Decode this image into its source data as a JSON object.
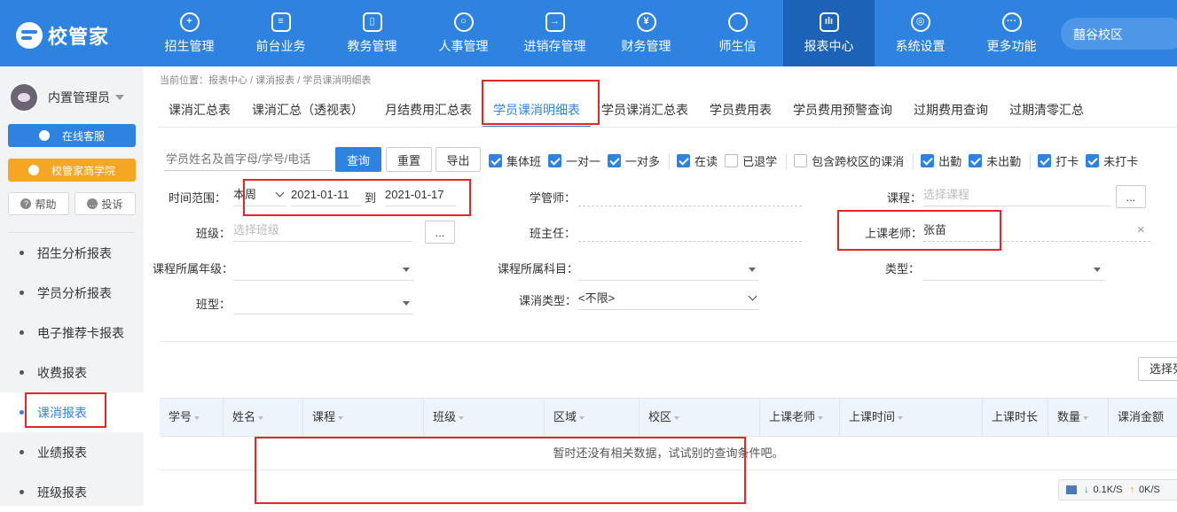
{
  "brand": {
    "name": "校管家"
  },
  "nav": [
    {
      "label": "招生管理",
      "icon": "user-plus-icon",
      "glyph": "+"
    },
    {
      "label": "前台业务",
      "icon": "front-desk-icon",
      "glyph": "≡"
    },
    {
      "label": "教务管理",
      "icon": "book-icon",
      "glyph": "▯"
    },
    {
      "label": "人事管理",
      "icon": "person-icon",
      "glyph": "○"
    },
    {
      "label": "进销存管理",
      "icon": "inventory-icon",
      "glyph": "→"
    },
    {
      "label": "财务管理",
      "icon": "yuan-icon",
      "glyph": "¥"
    },
    {
      "label": "师生信",
      "icon": "chat-icon",
      "glyph": ""
    },
    {
      "label": "报表中心",
      "icon": "chart-icon",
      "glyph": "ılı"
    },
    {
      "label": "系统设置",
      "icon": "gear-icon",
      "glyph": "◎"
    },
    {
      "label": "更多功能",
      "icon": "more-icon",
      "glyph": "···"
    }
  ],
  "campus": "囍谷校区",
  "user": {
    "name": "内置管理员"
  },
  "sidebar": {
    "online_service": "在线客服",
    "academy": "校管家商学院",
    "help": "帮助",
    "complaint": "投诉",
    "menu": [
      "招生分析报表",
      "学员分析报表",
      "电子推荐卡报表",
      "收费报表",
      "课消报表",
      "业绩报表",
      "班级报表"
    ]
  },
  "breadcrumb": "当前位置：报表中心 / 课消报表 / 学员课消明细表",
  "tabs": [
    "课消汇总表",
    "课消汇总（透视表）",
    "月结费用汇总表",
    "学员课消明细表",
    "学员课消汇总表",
    "学员费用表",
    "学员费用预警查询",
    "过期费用查询",
    "过期清零汇总"
  ],
  "toolbar": {
    "search_placeholder": "学员姓名及首字母/学号/电话",
    "query": "查询",
    "reset": "重置",
    "export": "导出"
  },
  "checkboxes": [
    {
      "label": "集体班",
      "checked": true
    },
    {
      "label": "一对一",
      "checked": true
    },
    {
      "label": "一对多",
      "checked": true
    },
    {
      "label": "在读",
      "checked": true
    },
    {
      "label": "已退学",
      "checked": false
    },
    {
      "label": "包含跨校区的课消",
      "checked": false
    },
    {
      "label": "出勤",
      "checked": true
    },
    {
      "label": "未出勤",
      "checked": true
    },
    {
      "label": "打卡",
      "checked": true
    },
    {
      "label": "未打卡",
      "checked": true
    }
  ],
  "filters": {
    "time_range_label": "时间范围：",
    "time_range_value": "本周",
    "date_from": "2021-01-11",
    "date_to_label": "到",
    "date_to": "2021-01-17",
    "advisor_label": "学管师：",
    "course_label": "课程：",
    "course_placeholder": "选择课程",
    "class_label": "班级：",
    "class_placeholder": "选择班级",
    "head_teacher_label": "班主任：",
    "teacher_label": "上课老师：",
    "teacher_value": "张苗",
    "grade_label": "课程所属年级：",
    "subject_label": "课程所属科目：",
    "type_label": "类型：",
    "class_type_label": "班型：",
    "consume_type_label": "课消类型：",
    "consume_type_value": "<不限>",
    "dots": "...",
    "clear": "×"
  },
  "select_columns": "选择列",
  "table": {
    "columns": [
      "学号",
      "姓名",
      "课程",
      "班级",
      "区域",
      "校区",
      "上课老师",
      "上课时间",
      "上课时长",
      "数量",
      "课消金额"
    ],
    "empty": "暂时还没有相关数据，试试别的查询条件吧。"
  },
  "netspeed": {
    "down": "0.1K/S",
    "up": "0K/S"
  }
}
